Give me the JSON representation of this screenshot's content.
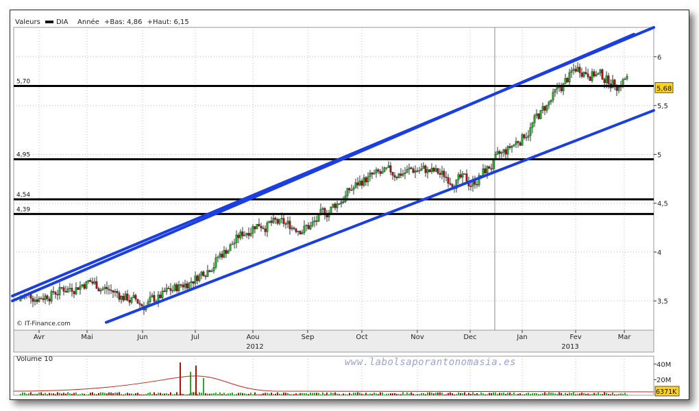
{
  "header": {
    "axis_label": "Valeurs",
    "ticker": "DIA",
    "period": "Année",
    "low_text": "+Bas: 4,86",
    "high_text": "+Haut: 6,15"
  },
  "source": "© IT-Finance.com",
  "watermark": "www.labolsaporantonomasia.es",
  "volume_label": "Volume 10",
  "colors": {
    "up": "#22aa22",
    "down": "#aa1111",
    "trend": "#1a3ee0",
    "level": "#000000",
    "badge": "#ffd21a"
  },
  "chart_data": {
    "type": "candlestick",
    "y_ticks": [
      "3,5",
      "4",
      "4,5",
      "5",
      "5,5",
      "6"
    ],
    "ylim": [
      3.2,
      6.3
    ],
    "x_month_labels": [
      "Avr",
      "Mai",
      "Jun",
      "Jul",
      "Aou",
      "Sep",
      "Oct",
      "Nov",
      "Dec",
      "Jan",
      "Fev",
      "Mar"
    ],
    "year_labels": [
      "2012",
      "2013"
    ],
    "horizontal_levels": [
      {
        "label": "5,70",
        "value": 5.7
      },
      {
        "label": "4,95",
        "value": 4.95
      },
      {
        "label": "4,54",
        "value": 4.54
      },
      {
        "label": "4,39",
        "value": 4.39
      }
    ],
    "last_price": {
      "label": "5,68",
      "value": 5.68
    },
    "trend_channel": [
      {
        "from_month": "Avr",
        "from_value": 3.55,
        "to_month": "Mar",
        "to_value": 6.3
      },
      {
        "from_month": "Avr",
        "from_value": 3.5,
        "to_month": "Mar",
        "to_value": 6.23
      },
      {
        "from_month": "Jun",
        "from_value": 3.28,
        "to_month": "Mar",
        "to_value": 5.45
      }
    ],
    "monthly_close": [
      3.55,
      3.7,
      3.45,
      3.75,
      4.3,
      4.25,
      4.75,
      4.85,
      4.7,
      5.2,
      5.9,
      5.68
    ],
    "volume": {
      "y_ticks": [
        "20M",
        "40M"
      ],
      "last_volume": "6371K",
      "spikes_month": [
        "Jun",
        "Jul",
        "Jul",
        "Jul"
      ],
      "spikes_value_M": [
        42,
        30,
        38,
        22
      ]
    }
  }
}
